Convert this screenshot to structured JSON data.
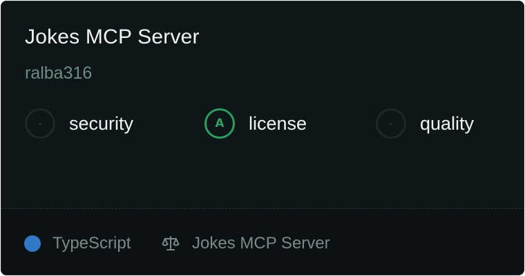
{
  "card": {
    "title": "Jokes MCP Server",
    "author": "ralba316"
  },
  "scores": [
    {
      "grade": "-",
      "label": "security"
    },
    {
      "grade": "A",
      "label": "license"
    },
    {
      "grade": "-",
      "label": "quality"
    }
  ],
  "footer": {
    "language": "TypeScript",
    "language_color": "#3178c6",
    "license_icon": "scale-icon",
    "license_text": "Jokes MCP Server"
  },
  "colors": {
    "card_background": "#0e1618",
    "grade_pass": "#2e9d63",
    "author": "#6f8a84"
  }
}
